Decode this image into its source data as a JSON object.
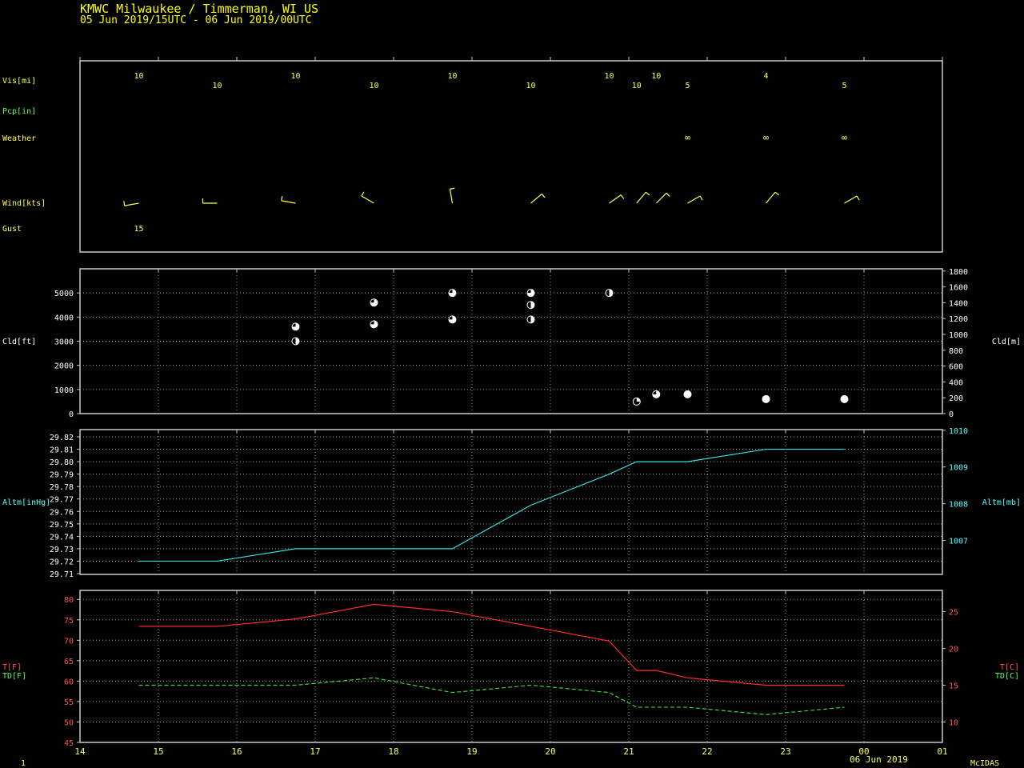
{
  "header": {
    "station": "KMWC  Milwaukee / Timmerman, WI US",
    "period": "05 Jun 2019/15UTC - 06 Jun 2019/00UTC"
  },
  "footer": {
    "frame_number": "1",
    "date_label": "06 Jun 2019",
    "software": "McIDAS"
  },
  "colors": {
    "background": "#000000",
    "frame": "#c8c8c8",
    "header_text": "#ffff00",
    "label_yellow": "#ffff55",
    "label_green": "#55ff55",
    "label_cyan": "#55ffff",
    "label_red": "#ff5555",
    "temperature": "#ff2a2a",
    "dewpoint": "#33dd33",
    "altimeter": "#33dddd",
    "cloud": "#ffffff",
    "wind": "#ffff55"
  },
  "time_axis": {
    "hours": [
      14,
      15,
      16,
      17,
      18,
      19,
      20,
      21,
      22,
      23,
      0,
      1
    ],
    "tick_labels": [
      "14",
      "15",
      "16",
      "17",
      "18",
      "19",
      "20",
      "21",
      "22",
      "23",
      "00",
      "01"
    ]
  },
  "chart_data": [
    {
      "type": "table",
      "panel": "surface",
      "row_labels": {
        "visibility": "Vis[mi]",
        "precip": "Pcp[in]",
        "weather": "Weather",
        "wind": "Wind[kts]",
        "gust": "Gust"
      },
      "visibility": [
        {
          "t": 14.75,
          "v": "10"
        },
        {
          "t": 15.75,
          "v": "10"
        },
        {
          "t": 16.75,
          "v": "10"
        },
        {
          "t": 17.75,
          "v": "10"
        },
        {
          "t": 18.75,
          "v": "10"
        },
        {
          "t": 19.75,
          "v": "10"
        },
        {
          "t": 20.75,
          "v": "10"
        },
        {
          "t": 21.1,
          "v": "10"
        },
        {
          "t": 21.35,
          "v": "10"
        },
        {
          "t": 21.75,
          "v": "5"
        },
        {
          "t": 22.75,
          "v": "4"
        },
        {
          "t": 23.75,
          "v": "5"
        }
      ],
      "weather": [
        {
          "t": 21.75,
          "symbol": "∞"
        },
        {
          "t": 22.75,
          "symbol": "∞"
        },
        {
          "t": 23.75,
          "symbol": "∞"
        }
      ],
      "wind": [
        {
          "t": 14.75,
          "dir_deg": 260,
          "speed_kt": 10
        },
        {
          "t": 15.75,
          "dir_deg": 270,
          "speed_kt": 10
        },
        {
          "t": 16.75,
          "dir_deg": 280,
          "speed_kt": 10
        },
        {
          "t": 17.75,
          "dir_deg": 300,
          "speed_kt": 10
        },
        {
          "t": 18.75,
          "dir_deg": 350,
          "speed_kt": 10
        },
        {
          "t": 19.75,
          "dir_deg": 50,
          "speed_kt": 10
        },
        {
          "t": 20.75,
          "dir_deg": 55,
          "speed_kt": 10
        },
        {
          "t": 21.1,
          "dir_deg": 40,
          "speed_kt": 10
        },
        {
          "t": 21.35,
          "dir_deg": 45,
          "speed_kt": 10
        },
        {
          "t": 21.75,
          "dir_deg": 60,
          "speed_kt": 10
        },
        {
          "t": 22.75,
          "dir_deg": 40,
          "speed_kt": 10
        },
        {
          "t": 23.75,
          "dir_deg": 60,
          "speed_kt": 10
        }
      ],
      "gust": [
        {
          "t": 14.75,
          "v": "15"
        }
      ]
    },
    {
      "type": "scatter",
      "panel": "cloud",
      "ylabel_left": "Cld[ft]",
      "ylabel_right": "Cld[m]",
      "ylim": [
        0,
        6000
      ],
      "left_ticks": [
        0,
        1000,
        2000,
        3000,
        4000,
        5000
      ],
      "right_ticks": [
        0,
        200,
        400,
        600,
        800,
        1000,
        1200,
        1400,
        1600,
        1800
      ],
      "points": [
        {
          "t": 16.75,
          "h": 3600,
          "cover": "BKN"
        },
        {
          "t": 16.75,
          "h": 3000,
          "cover": "SCT"
        },
        {
          "t": 17.75,
          "h": 4600,
          "cover": "BKN"
        },
        {
          "t": 17.75,
          "h": 3700,
          "cover": "BKN"
        },
        {
          "t": 18.75,
          "h": 5000,
          "cover": "BKN"
        },
        {
          "t": 18.75,
          "h": 3900,
          "cover": "BKN"
        },
        {
          "t": 19.75,
          "h": 5000,
          "cover": "BKN"
        },
        {
          "t": 19.75,
          "h": 4500,
          "cover": "SCT"
        },
        {
          "t": 19.75,
          "h": 3900,
          "cover": "SCT"
        },
        {
          "t": 20.75,
          "h": 5000,
          "cover": "SCT"
        },
        {
          "t": 21.1,
          "h": 500,
          "cover": "FEW"
        },
        {
          "t": 21.35,
          "h": 800,
          "cover": "BKN"
        },
        {
          "t": 21.75,
          "h": 800,
          "cover": "OVC"
        },
        {
          "t": 22.75,
          "h": 600,
          "cover": "OVC"
        },
        {
          "t": 23.75,
          "h": 600,
          "cover": "OVC"
        }
      ]
    },
    {
      "type": "line",
      "panel": "altimeter",
      "ylabel_left": "Altm[inHg]",
      "ylabel_right": "Altm[mb]",
      "ylim": [
        29.71,
        29.82
      ],
      "left_ticks": [
        29.71,
        29.72,
        29.73,
        29.74,
        29.75,
        29.76,
        29.77,
        29.78,
        29.79,
        29.8,
        29.81,
        29.82
      ],
      "left_tick_labels": [
        "29.71",
        "29.72",
        "29.73",
        "29.74",
        "29.75",
        "29.76",
        "29.77",
        "29.78",
        "29.79",
        "29.80",
        "29.81",
        "29.82"
      ],
      "right_ticks": [
        1007,
        1008,
        1009,
        1010
      ],
      "x": [
        14.75,
        15.75,
        16.75,
        17.75,
        18.75,
        19.75,
        20.75,
        21.1,
        21.75,
        22.75,
        23.75
      ],
      "values": [
        29.72,
        29.72,
        29.73,
        29.73,
        29.73,
        29.765,
        29.79,
        29.8,
        29.8,
        29.81,
        29.81
      ]
    },
    {
      "type": "line",
      "panel": "temperature",
      "ylabel_left_1": "T[F]",
      "ylabel_left_2": "TD[F]",
      "ylabel_right_1": "T[C]",
      "ylabel_right_2": "TD[C]",
      "ylim": [
        45,
        82.2
      ],
      "left_ticks": [
        45,
        50,
        55,
        60,
        65,
        70,
        75,
        80
      ],
      "right_ticks": [
        10,
        15,
        20,
        25
      ],
      "series": [
        {
          "key": "T",
          "x": [
            14.75,
            15.75,
            16.75,
            17.75,
            18.75,
            19.75,
            20.75,
            21.1,
            21.35,
            21.75,
            22.75,
            23.75
          ],
          "values": [
            73.4,
            73.4,
            75.2,
            78.8,
            77.0,
            73.4,
            69.8,
            62.6,
            62.6,
            60.8,
            59.0,
            59.0
          ]
        },
        {
          "key": "TD",
          "x": [
            14.75,
            15.75,
            16.75,
            17.75,
            18.75,
            19.75,
            20.75,
            21.1,
            21.35,
            21.75,
            22.75,
            23.75
          ],
          "values": [
            59.0,
            59.0,
            59.0,
            60.8,
            57.2,
            59.0,
            57.2,
            53.6,
            53.6,
            53.6,
            51.8,
            53.6
          ]
        }
      ]
    }
  ]
}
